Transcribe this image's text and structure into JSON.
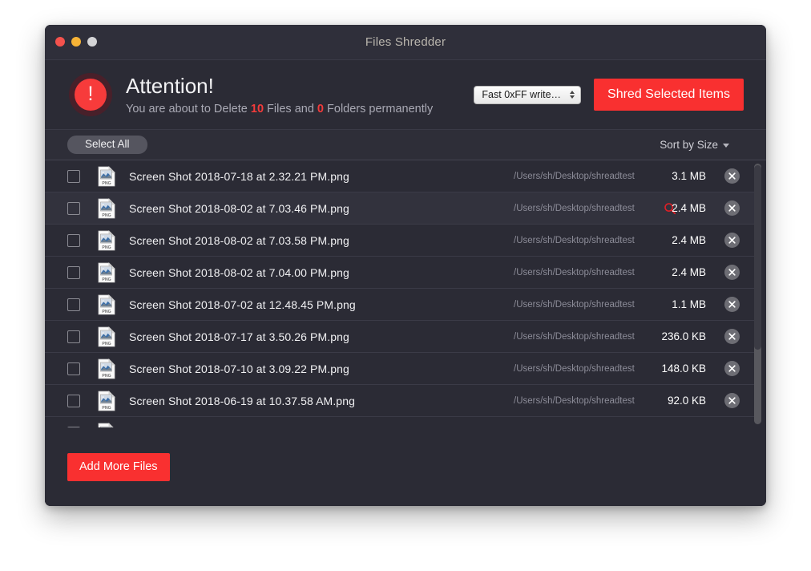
{
  "window": {
    "title": "Files Shredder",
    "traffic_lights": [
      "close-red",
      "minimize-yellow",
      "zoom-grey"
    ]
  },
  "attention": {
    "icon": "warning-exclamation-icon",
    "title": "Attention!",
    "subtitle_prefix": "You are about to Delete",
    "file_count": "10",
    "subtitle_mid": "Files and",
    "folder_count": "0",
    "subtitle_suffix": "Folders permanently",
    "method_select_value": "Fast 0xFF write…",
    "shred_button_label": "Shred Selected Items",
    "accent_red": "#f93030",
    "warning_red": "#f73b3b"
  },
  "toolbar": {
    "select_all_label": "Select All",
    "sort_label": "Sort by Size"
  },
  "files": [
    {
      "name": "Screen Shot 2018-07-18 at 2.32.21 PM.png",
      "path": "/Users/sh/Desktop/shreadtest",
      "size": "3.1 MB",
      "checked": false,
      "hovered": false
    },
    {
      "name": "Screen Shot 2018-08-02 at 7.03.46 PM.png",
      "path": "/Users/sh/Desktop/shreadtest",
      "size": "2.4 MB",
      "checked": false,
      "hovered": true
    },
    {
      "name": "Screen Shot 2018-08-02 at 7.03.58 PM.png",
      "path": "/Users/sh/Desktop/shreadtest",
      "size": "2.4 MB",
      "checked": false,
      "hovered": false
    },
    {
      "name": "Screen Shot 2018-08-02 at 7.04.00 PM.png",
      "path": "/Users/sh/Desktop/shreadtest",
      "size": "2.4 MB",
      "checked": false,
      "hovered": false
    },
    {
      "name": "Screen Shot 2018-07-02 at 12.48.45 PM.png",
      "path": "/Users/sh/Desktop/shreadtest",
      "size": "1.1 MB",
      "checked": false,
      "hovered": false
    },
    {
      "name": "Screen Shot 2018-07-17 at 3.50.26 PM.png",
      "path": "/Users/sh/Desktop/shreadtest",
      "size": "236.0 KB",
      "checked": false,
      "hovered": false
    },
    {
      "name": "Screen Shot 2018-07-10 at 3.09.22 PM.png",
      "path": "/Users/sh/Desktop/shreadtest",
      "size": "148.0 KB",
      "checked": false,
      "hovered": false
    },
    {
      "name": "Screen Shot 2018-06-19 at 10.37.58 AM.png",
      "path": "/Users/sh/Desktop/shreadtest",
      "size": "92.0 KB",
      "checked": false,
      "hovered": false
    }
  ],
  "footer": {
    "add_more_label": "Add More Files"
  }
}
